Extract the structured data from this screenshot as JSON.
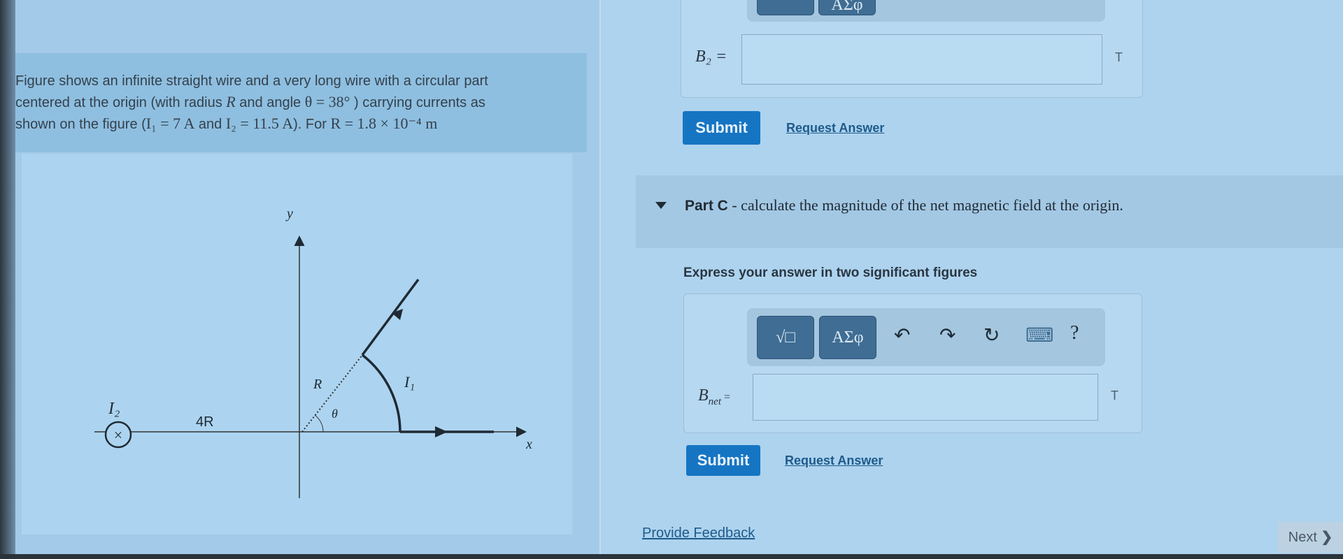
{
  "problem": {
    "text_line1": "Figure shows an infinite straight wire and a very long wire with a circular part",
    "text_line2_a": "centered at the origin  (with radius ",
    "text_line2_R": "R",
    "text_line2_b": " and angle ",
    "text_line2_theta": "θ = 38°",
    "text_line2_c": " ) carrying currents as",
    "text_line3_a": "shown on the figure (",
    "text_line3_I1": "I₁ = 7 A",
    "text_line3_b": "  and ",
    "text_line3_I2": "I₂ = 11.5 A",
    "text_line3_c": "). For ",
    "text_line3_R": "R = 1.8 × 10⁻⁴ m"
  },
  "figure": {
    "y_label": "y",
    "x_label": "x",
    "I2_label": "I₂",
    "I2_symbol": "×",
    "distance_label": "4R",
    "radius_label": "R",
    "angle_label": "θ",
    "I1_label": "I₁"
  },
  "part_b": {
    "toolbar_sym": "ΑΣφ",
    "answer_label": "B₂ =",
    "unit": "T",
    "submit": "Submit",
    "request_answer": "Request Answer"
  },
  "part_c": {
    "title_bold": "Part C",
    "title_rest": " - calculate the magnitude of the net magnetic field  at the origin.",
    "instruction": "Express your answer in two significant figures",
    "toolbar": {
      "templates_icon": "√□",
      "symbols": "ΑΣφ",
      "undo": "↶",
      "redo": "↷",
      "reset": "↻",
      "keyboard": "⌨",
      "help": "?"
    },
    "answer_label_main": "B",
    "answer_label_sub": "net",
    "answer_label_eq": " =",
    "unit": "T",
    "submit": "Submit",
    "request_answer": "Request Answer"
  },
  "footer": {
    "provide_feedback": "Provide Feedback",
    "next": "Next",
    "next_icon": "chevron-right"
  },
  "colors": {
    "submit": "#1675c3",
    "link": "#1d5b8c"
  }
}
